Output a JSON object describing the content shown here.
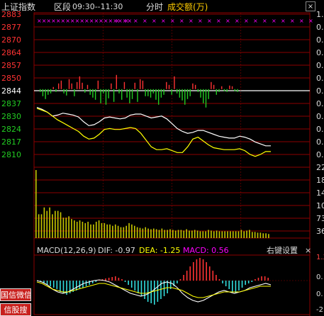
{
  "header": {
    "index_name": "上证指数",
    "range_label": "区段",
    "time_range": "09:30--11:30",
    "mode_label": "分时",
    "volume_label": "成交额(万)"
  },
  "macd_header": {
    "params": "MACD(12,26,9)",
    "dif": "DIF: -0.97",
    "dea": "DEA: -1.25",
    "macd": "MACD: 0.56",
    "settings": "右键设置",
    "close": "×"
  },
  "side_buttons": [
    "国信微信",
    "信股搜"
  ],
  "colors": {
    "grid": "#8b0000",
    "up": "#ff3333",
    "down": "#22cc22",
    "price_line": "#ffffff",
    "avg_line": "#ffff00",
    "volume": "#c8c800",
    "magenta": "#ff00ff",
    "macd_pos": "#ff3333",
    "macd_neg": "#33dddd"
  },
  "chart_data": [
    {
      "type": "line",
      "title": "上证指数 分时",
      "base_price": 2844,
      "y_ticks": [
        2883,
        2877,
        2870,
        2864,
        2857,
        2850,
        2844,
        2837,
        2830,
        2824,
        2817,
        2810
      ],
      "y_tick_labels": [
        "2883",
        "2877",
        "2870",
        "2864",
        "2857",
        "2850",
        "2844",
        "2837",
        "2830",
        "2824",
        "2817",
        "2810"
      ],
      "right_tick_labels": [
        "1.",
        "0.",
        "0.",
        "0.",
        "0.",
        "0.",
        "0.",
        "0.",
        "0.",
        "0.",
        "0.",
        "0."
      ],
      "series": [
        {
          "name": "price",
          "values": [
            2834.5,
            2833.5,
            2832,
            2830,
            2830.5,
            2831.5,
            2831,
            2830.5,
            2829.5,
            2827,
            2825,
            2825.5,
            2827,
            2829,
            2829.5,
            2829,
            2828.5,
            2829,
            2830.5,
            2831,
            2831,
            2830,
            2829,
            2829.5,
            2830,
            2828.5,
            2826,
            2823.5,
            2822,
            2821,
            2821.5,
            2822.5,
            2822.5,
            2821.5,
            2820.5,
            2819.5,
            2819,
            2818.5,
            2818.5,
            2819.5,
            2819,
            2818,
            2816.5,
            2815.5,
            2814.5,
            2814.5
          ]
        },
        {
          "name": "avg",
          "values": [
            2834,
            2833,
            2832,
            2830,
            2828,
            2826.5,
            2825,
            2823.5,
            2822,
            2819.5,
            2818,
            2818.5,
            2820.5,
            2823,
            2823.5,
            2823,
            2823,
            2823.5,
            2824,
            2823.5,
            2821,
            2817.5,
            2814,
            2812.5,
            2812.5,
            2813,
            2812,
            2811,
            2811,
            2814,
            2818,
            2819,
            2817,
            2815,
            2813.5,
            2813,
            2812.5,
            2812.5,
            2812.5,
            2813,
            2812,
            2810,
            2809,
            2810,
            2811.5,
            2811.5
          ]
        }
      ],
      "upper_markers": "××××××××××××××××××××"
    },
    {
      "type": "bar",
      "title": "成交额(万)",
      "y_tick_labels": [
        "22",
        "18",
        "14",
        "109",
        "73",
        "36"
      ],
      "values": [
        100,
        35,
        35,
        45,
        40,
        45,
        35,
        40,
        40,
        38,
        30,
        30,
        32,
        28,
        26,
        24,
        26,
        24,
        22,
        24,
        20,
        20,
        24,
        26,
        22,
        22,
        20,
        20,
        18,
        20,
        18,
        16,
        16,
        18,
        22,
        20,
        18,
        16,
        15,
        14,
        16,
        14,
        13,
        14,
        13,
        12,
        14,
        12,
        12,
        13,
        12,
        11,
        12,
        12,
        11,
        13,
        11,
        11,
        12,
        11,
        10,
        10,
        10,
        12,
        11,
        10,
        11,
        10,
        10,
        10,
        10,
        10,
        10,
        10,
        10,
        12,
        10,
        11,
        12,
        9,
        9,
        8,
        8,
        7,
        7,
        6
      ]
    },
    {
      "type": "bar",
      "title": "MACD(12,26,9)",
      "series": [
        {
          "name": "DIF",
          "value": -0.97
        },
        {
          "name": "DEA",
          "value": -1.25
        },
        {
          "name": "MACD",
          "value": 0.56
        }
      ],
      "y_tick_labels": [
        "1.3",
        "0.",
        "0.",
        "-2."
      ]
    }
  ]
}
